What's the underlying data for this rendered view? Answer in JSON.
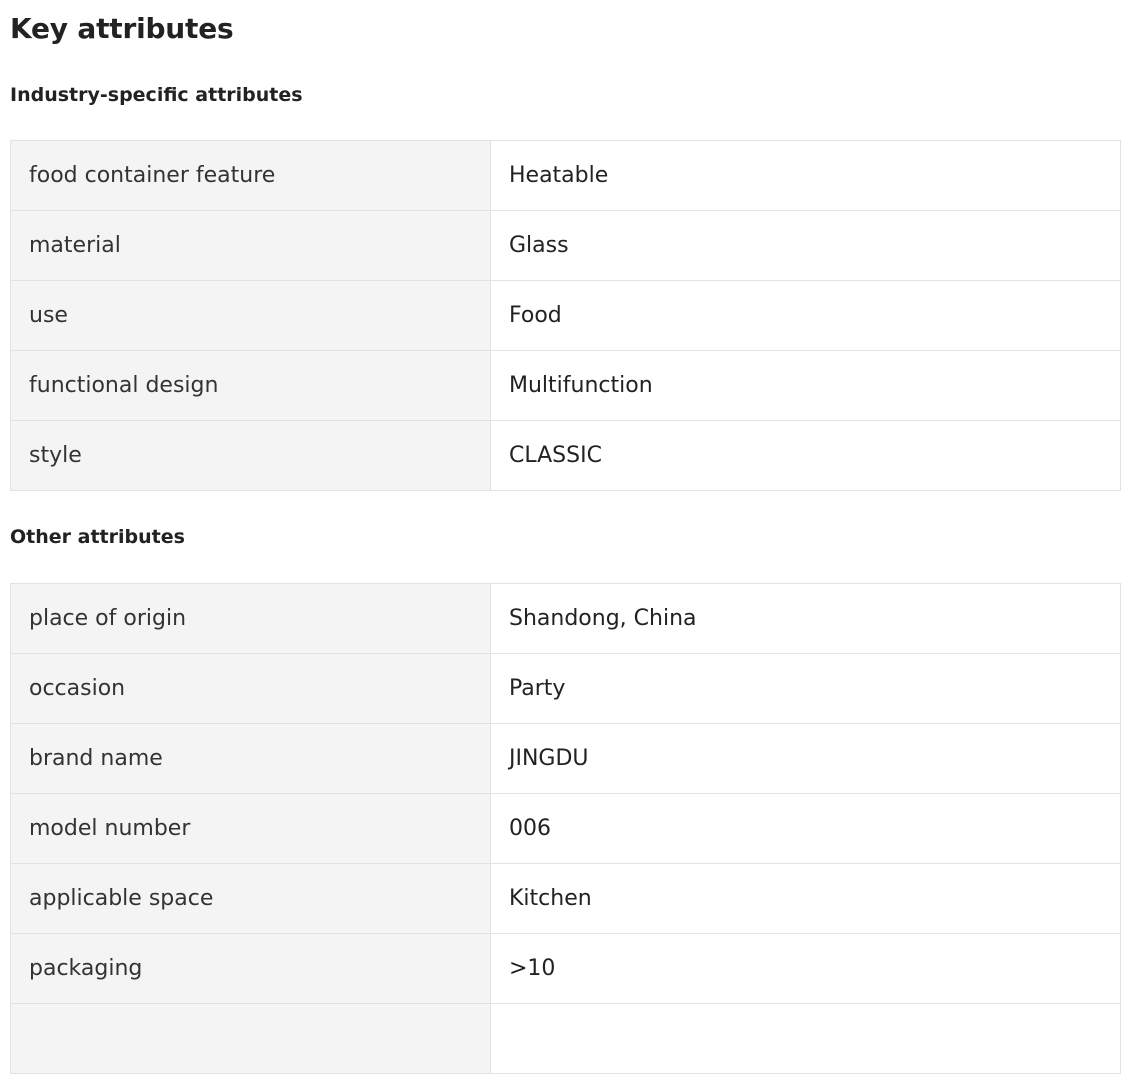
{
  "page_title": "Key attributes",
  "sections": [
    {
      "title": "Industry-specific attributes",
      "rows": [
        {
          "name": "food container feature",
          "value": "Heatable"
        },
        {
          "name": "material",
          "value": "Glass"
        },
        {
          "name": "use",
          "value": "Food"
        },
        {
          "name": "functional design",
          "value": "Multifunction"
        },
        {
          "name": "style",
          "value": "CLASSIC"
        }
      ]
    },
    {
      "title": "Other attributes",
      "rows": [
        {
          "name": "place of origin",
          "value": "Shandong, China"
        },
        {
          "name": "occasion",
          "value": "Party"
        },
        {
          "name": "brand name",
          "value": "JINGDU"
        },
        {
          "name": "model number",
          "value": "006"
        },
        {
          "name": "applicable space",
          "value": "Kitchen"
        },
        {
          "name": "packaging",
          "value": ">10"
        }
      ]
    }
  ]
}
